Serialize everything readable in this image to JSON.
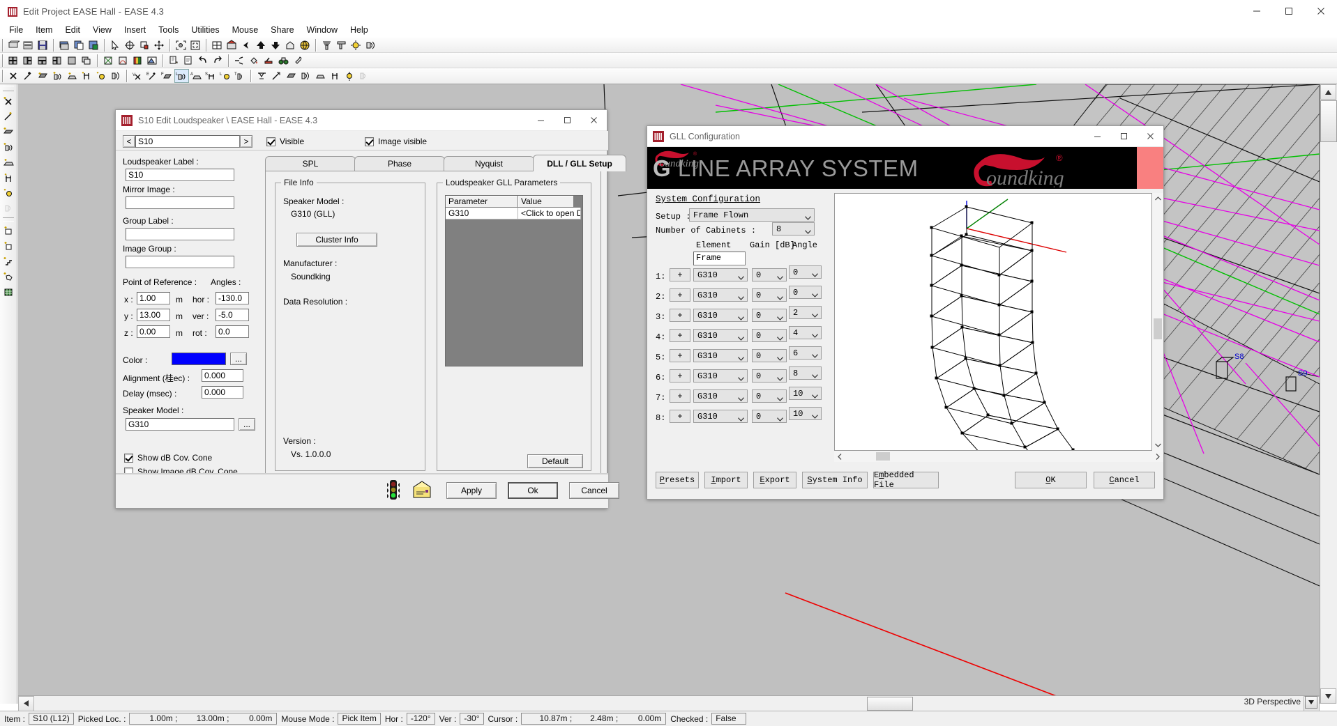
{
  "window": {
    "title": "Edit Project EASE Hall - EASE 4.3",
    "icon": "ease-logo-icon",
    "minimize": "minimize-icon",
    "maximize": "maximize-icon",
    "close": "close-icon"
  },
  "menu": [
    "File",
    "Item",
    "Edit",
    "View",
    "Insert",
    "Tools",
    "Utilities",
    "Mouse",
    "Share",
    "Window",
    "Help"
  ],
  "canvas": {
    "view_label": "3D Perspective"
  },
  "statusbar": {
    "item_label": "Item :",
    "item_value": "S10 (L12)",
    "picked_label": "Picked Loc. :",
    "picked_x": "1.00m ;",
    "picked_y": "13.00m ;",
    "picked_z": "0.00m",
    "mouse_mode_label": "Mouse Mode :",
    "mouse_mode_value": "Pick Item",
    "hor_label": "Hor :",
    "hor_value": "-120°",
    "ver_label": "Ver :",
    "ver_value": "-30°",
    "cursor_label": "Cursor :",
    "cursor_x": "10.87m ;",
    "cursor_y": "2.48m ;",
    "cursor_z": "0.00m",
    "checked_label": "Checked :",
    "checked_value": "False"
  },
  "edit_loudspeaker": {
    "title": "S10 Edit Loudspeaker \\ EASE Hall - EASE 4.3",
    "nav_prev": "<",
    "nav_next": ">",
    "nav_value": "S10",
    "visible_label": "Visible",
    "visible_checked": true,
    "image_visible_label": "Image visible",
    "image_visible_checked": true,
    "fields": {
      "loudspeaker_label_caption": "Loudspeaker Label :",
      "loudspeaker_label_value": "S10",
      "mirror_image_caption": "Mirror Image :",
      "mirror_image_value": "",
      "group_label_caption": "Group Label :",
      "group_label_value": "",
      "image_group_caption": "Image Group :",
      "image_group_value": "",
      "point_of_reference_caption": "Point of Reference :",
      "angles_caption": "Angles :",
      "x_label": "x :",
      "x_value": "1.00",
      "y_label": "y :",
      "y_value": "13.00",
      "z_label": "z :",
      "z_value": "0.00",
      "unit": "m",
      "hor_label": "hor :",
      "hor_value": "-130.0",
      "ver_label": "ver :",
      "ver_value": "-5.0",
      "rot_label": "rot :",
      "rot_value": "0.0",
      "color_caption": "Color :",
      "color_value": "#0000ff",
      "color_browse": "...",
      "alignment_caption": "Alignment (桂ec) :",
      "alignment_value": "0.000",
      "delay_caption": "Delay (msec) :",
      "delay_value": "0.000",
      "speaker_model_caption": "Speaker Model :",
      "speaker_model_value": "G310",
      "speaker_model_browse": "...",
      "show_db_cov_cone": "Show dB Cov. Cone",
      "show_db_cov_cone_checked": true,
      "show_image_db_cov_cone": "Show Image dB Cov. Cone",
      "show_image_db_cov_cone_checked": false
    },
    "tabs": [
      {
        "label": "SPL",
        "active": false
      },
      {
        "label": "Phase",
        "active": false
      },
      {
        "label": "Nyquist",
        "active": false
      },
      {
        "label": "DLL / GLL Setup",
        "active": true
      }
    ],
    "file_info": {
      "legend": "File Info",
      "speaker_model_caption": "Speaker Model :",
      "speaker_model_value": "G310 (GLL)",
      "cluster_info_button": "Cluster Info",
      "manufacturer_caption": "Manufacturer :",
      "manufacturer_value": "Soundking",
      "data_resolution_caption": "Data Resolution :",
      "data_resolution_value": "",
      "version_caption": "Version :",
      "version_value": "Vs. 1.0.0.0"
    },
    "gll_params": {
      "legend": "Loudspeaker GLL Parameters",
      "columns": [
        "Parameter",
        "Value"
      ],
      "rows": [
        {
          "parameter": "G310",
          "value": "<Click to open Dialog>"
        }
      ],
      "default_button": "Default"
    },
    "footer": {
      "traffic_light_icon": "traffic-light-icon",
      "note_icon": "note-icon",
      "apply": "Apply",
      "ok": "Ok",
      "cancel": "Cancel"
    }
  },
  "gll_configuration": {
    "title": "GLL Configuration",
    "banner": {
      "logo_text": "Soundking",
      "headline_bold": "G",
      "headline_rest": " LINE ARRAY SYSTEM",
      "accent_color": "#f98080",
      "brand_color": "#c8102e"
    },
    "system_configuration": {
      "heading": "System Configuration",
      "setup_label": "Setup :",
      "setup_value": "Frame Flown",
      "number_of_cabinets_label": "Number of Cabinets :",
      "number_of_cabinets_value": "8",
      "col_element": "Element",
      "col_gain": "Gain [dB]",
      "col_angle": "Angle",
      "frame_value": "Frame",
      "add_button": "+",
      "rows": [
        {
          "index": "1:",
          "element": "G310",
          "gain": "0",
          "angle": "0"
        },
        {
          "index": "2:",
          "element": "G310",
          "gain": "0",
          "angle": "0"
        },
        {
          "index": "3:",
          "element": "G310",
          "gain": "0",
          "angle": "2"
        },
        {
          "index": "4:",
          "element": "G310",
          "gain": "0",
          "angle": "4"
        },
        {
          "index": "5:",
          "element": "G310",
          "gain": "0",
          "angle": "6"
        },
        {
          "index": "6:",
          "element": "G310",
          "gain": "0",
          "angle": "8"
        },
        {
          "index": "7:",
          "element": "G310",
          "gain": "0",
          "angle": "10"
        },
        {
          "index": "8:",
          "element": "G310",
          "gain": "0",
          "angle": "10"
        }
      ]
    },
    "buttons": {
      "presets": "Presets",
      "import": "Import",
      "export": "Export",
      "system_info": "System Info",
      "embedded_file": "Embedded File",
      "ok": "OK",
      "cancel": "Cancel"
    }
  }
}
